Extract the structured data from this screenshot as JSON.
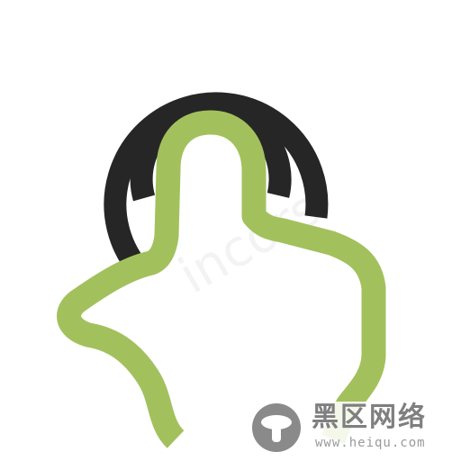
{
  "icon": {
    "name": "touch-hand-icon",
    "colors": {
      "waves": "#262626",
      "hand": "#a2c15d",
      "background": "#ffffff"
    }
  },
  "background_watermark": {
    "text": "incors"
  },
  "watermark": {
    "title": "黑区网络",
    "url": "www.heiqu.com"
  }
}
